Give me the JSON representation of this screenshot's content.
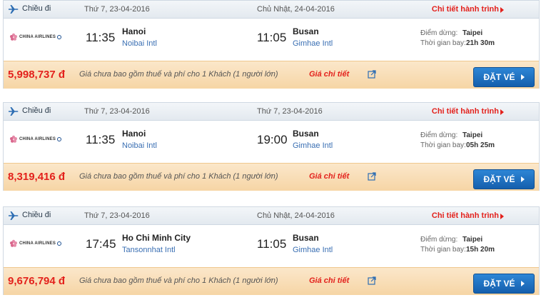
{
  "results": [
    {
      "direction_label": "Chiều đi",
      "depart_date": "Thứ 7, 23-04-2016",
      "arrive_date": "Chủ Nhật, 24-04-2016",
      "detail_link": "Chi tiết hành trình",
      "airline_logo_text": "CHINA AIRLINES",
      "depart_time": "11:35",
      "depart_city": "Hanoi",
      "depart_airport": "Noibai Intl",
      "arrive_time": "11:05",
      "arrive_city": "Busan",
      "arrive_airport": "Gimhae Intl",
      "stop_label": "Điểm dừng:",
      "stop_value": "Taipei",
      "duration_label": "Thời gian bay:",
      "duration_value": "21h 30m",
      "price": "5,998,737 đ",
      "price_note": "Giá chưa bao gồm thuế và phí cho 1 Khách (1 người lớn)",
      "price_detail": "Giá chi tiết",
      "book_label": "ĐẶT VÉ"
    },
    {
      "direction_label": "Chiều đi",
      "depart_date": "Thứ 7, 23-04-2016",
      "arrive_date": "Thứ 7, 23-04-2016",
      "detail_link": "Chi tiết hành trình",
      "airline_logo_text": "CHINA AIRLINES",
      "depart_time": "11:35",
      "depart_city": "Hanoi",
      "depart_airport": "Noibai Intl",
      "arrive_time": "19:00",
      "arrive_city": "Busan",
      "arrive_airport": "Gimhae Intl",
      "stop_label": "Điểm dừng:",
      "stop_value": "Taipei",
      "duration_label": "Thời gian bay:",
      "duration_value": "05h 25m",
      "price": "8,319,416 đ",
      "price_note": "Giá chưa bao gồm thuế và phí cho 1 Khách (1 người lớn)",
      "price_detail": "Giá chi tiết",
      "book_label": "ĐẶT VÉ"
    },
    {
      "direction_label": "Chiều đi",
      "depart_date": "Thứ 7, 23-04-2016",
      "arrive_date": "Chủ Nhật, 24-04-2016",
      "detail_link": "Chi tiết hành trình",
      "airline_logo_text": "CHINA AIRLINES",
      "depart_time": "17:45",
      "depart_city": "Ho Chi Minh City",
      "depart_airport": "Tansonnhat Intl",
      "arrive_time": "11:05",
      "arrive_city": "Busan",
      "arrive_airport": "Gimhae Intl",
      "stop_label": "Điểm dừng:",
      "stop_value": "Taipei",
      "duration_label": "Thời gian bay:",
      "duration_value": "15h 20m",
      "price": "9,676,794 đ",
      "price_note": "Giá chưa bao gồm thuế và phí cho 1 Khách (1 người lớn)",
      "price_detail": "Giá chi tiết",
      "book_label": "ĐẶT VÉ"
    }
  ],
  "icons": {
    "direction": "airplane-icon",
    "detail": "arrow-right-icon",
    "price_detail": "external-link-icon",
    "book": "arrow-right-icon",
    "logo": "plum-blossom-icon"
  },
  "colors": {
    "accent_red": "#e3211c",
    "link_blue": "#3a6fb3",
    "book_blue": "#1a6fc4",
    "price_bar": "#f8dcb4",
    "header_bar": "#e9eef3"
  }
}
